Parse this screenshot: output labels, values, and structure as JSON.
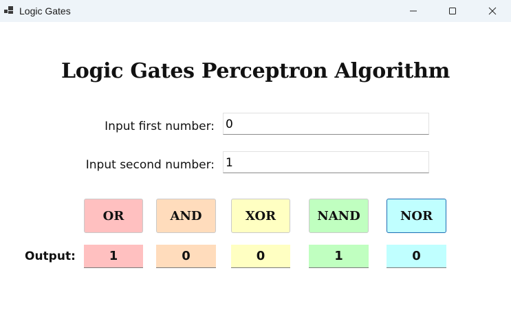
{
  "window": {
    "title": "Logic Gates",
    "icon": "app-window-icon"
  },
  "heading": "Logic Gates Perceptron Algorithm",
  "inputs": {
    "first_label": "Input first number:",
    "first_value": "0",
    "second_label": "Input second number:",
    "second_value": "1"
  },
  "gates": {
    "or": "OR",
    "and": "AND",
    "xor": "XOR",
    "nand": "NAND",
    "nor": "NOR"
  },
  "output": {
    "label": "Output:",
    "or": "1",
    "and": "0",
    "xor": "0",
    "nand": "1",
    "nor": "0"
  },
  "colors": {
    "or": "#ffc0c0",
    "and": "#ffdcbc",
    "xor": "#ffffc2",
    "nand": "#c0ffc0",
    "nor": "#c0ffff",
    "titlebar": "#eef4f9"
  }
}
